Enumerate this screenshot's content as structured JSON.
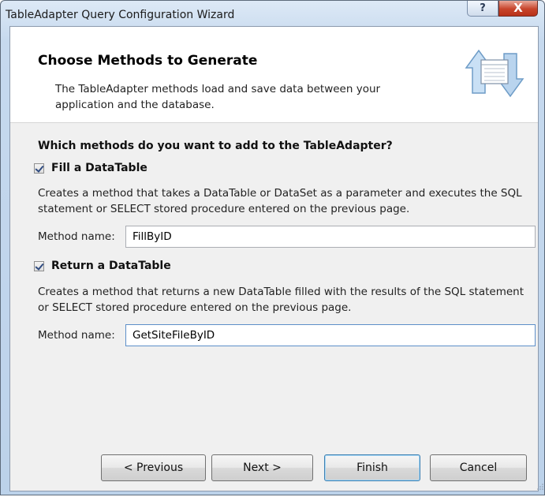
{
  "window": {
    "title": "TableAdapter Query Configuration Wizard",
    "help_label": "?",
    "close_label": "X"
  },
  "header": {
    "title": "Choose Methods to Generate",
    "description": "The TableAdapter methods load and save data between your application and the database.",
    "icon": "wizard-arrows-icon"
  },
  "question": "Which methods do you want to add to the TableAdapter?",
  "fill": {
    "checked": true,
    "label": "Fill a DataTable",
    "description": "Creates a method that takes a DataTable or DataSet as a parameter and executes the SQL statement or SELECT stored procedure entered on the previous page.",
    "method_label": "Method name:",
    "method_value": "FillByID"
  },
  "return": {
    "checked": true,
    "label": "Return a DataTable",
    "description": "Creates a method that returns a new DataTable filled with the results of the SQL statement or SELECT stored procedure entered on the previous page.",
    "method_label": "Method name:",
    "method_value": "GetSiteFileByID"
  },
  "buttons": {
    "previous": "< Previous",
    "next": "Next >",
    "finish": "Finish",
    "cancel": "Cancel"
  },
  "colors": {
    "title_gradient": "#c6d9ee",
    "close_red": "#c7442b",
    "panel": "#f0f0f0",
    "default_button_border": "#3c7fb1"
  }
}
